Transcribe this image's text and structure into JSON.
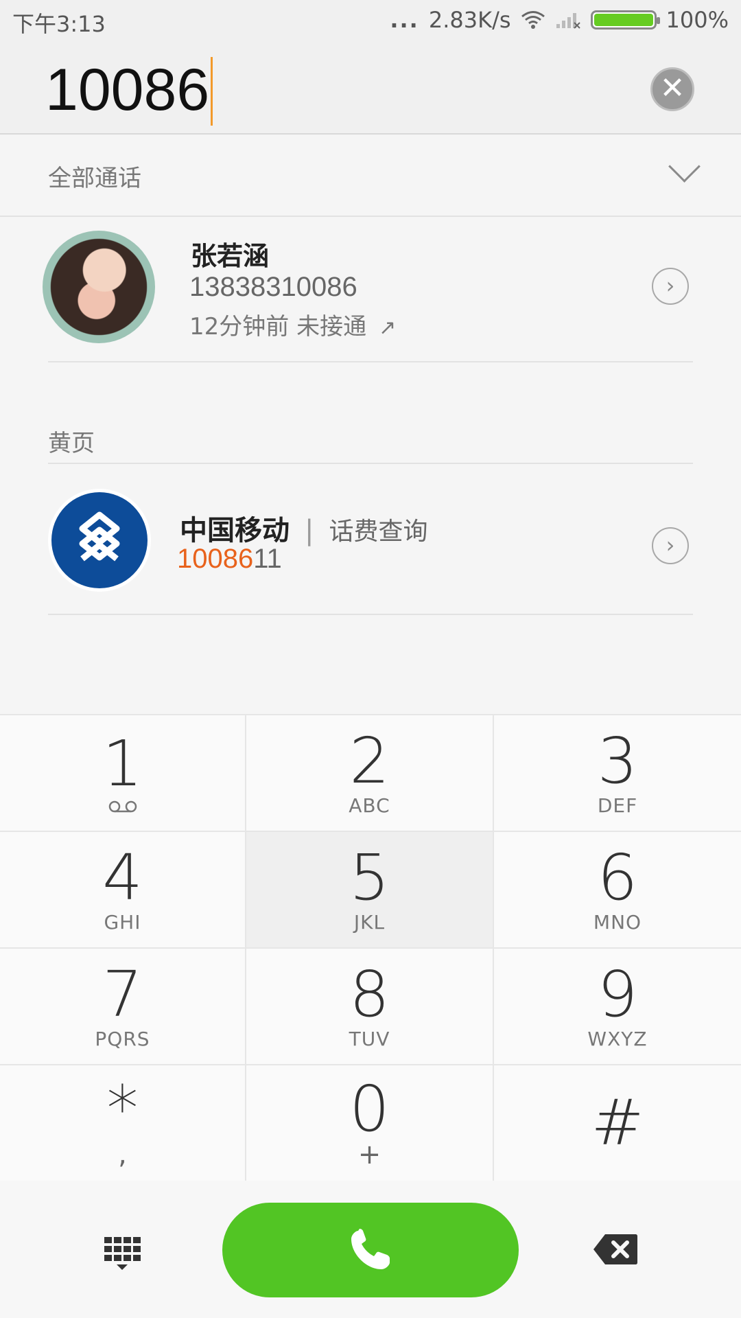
{
  "status_bar": {
    "time": "下午3:13",
    "dots": "...",
    "net_speed": "2.83K/s",
    "battery_pct": "100%",
    "battery_level": 1.0
  },
  "dial_input": {
    "value": "10086"
  },
  "filter": {
    "label": "全部通话"
  },
  "recent_call": {
    "name": "张若涵",
    "number": "13838310086",
    "meta": "12分钟前 未接通",
    "arrow": "↗"
  },
  "yellow_pages": {
    "section_title": "黄页",
    "name": "中国移动",
    "divider": "|",
    "tag": "话费查询",
    "number_match": "10086",
    "number_rest": "11"
  },
  "keypad": {
    "keys": [
      {
        "digit": "1",
        "letters": ""
      },
      {
        "digit": "2",
        "letters": "ABC"
      },
      {
        "digit": "3",
        "letters": "DEF"
      },
      {
        "digit": "4",
        "letters": "GHI"
      },
      {
        "digit": "5",
        "letters": "JKL"
      },
      {
        "digit": "6",
        "letters": "MNO"
      },
      {
        "digit": "7",
        "letters": "PQRS"
      },
      {
        "digit": "8",
        "letters": "TUV"
      },
      {
        "digit": "9",
        "letters": "WXYZ"
      },
      {
        "digit": "*",
        "letters": ","
      },
      {
        "digit": "0",
        "letters": "+"
      },
      {
        "digit": "#",
        "letters": ""
      }
    ]
  },
  "colors": {
    "call_green": "#52c524",
    "match_orange": "#e8621c",
    "caret": "#f39a2a",
    "brand_blue": "#0d4c99"
  },
  "icons": {
    "clear": "close-icon",
    "voicemail": "voicemail-icon",
    "call": "phone-icon",
    "backspace": "backspace-icon",
    "keypad": "keypad-icon"
  }
}
